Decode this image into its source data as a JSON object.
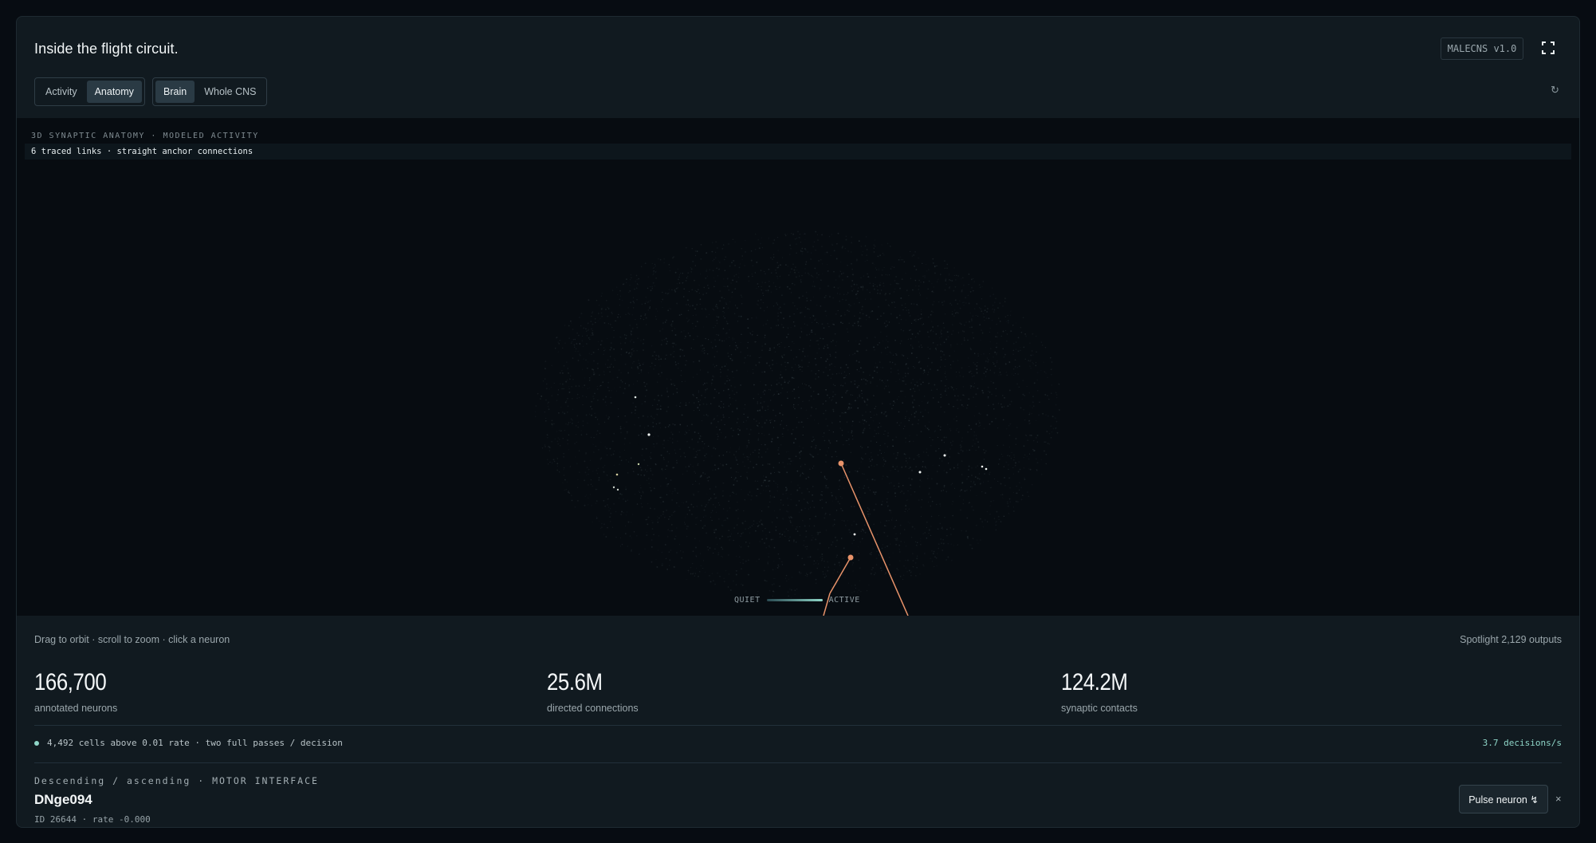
{
  "header": {
    "title": "Inside the flight circuit.",
    "version": "MALECNS v1.0",
    "refresh_glyph": "↻"
  },
  "view_toggle": {
    "options": [
      "Activity",
      "Anatomy"
    ],
    "selected": "Anatomy"
  },
  "scope_toggle": {
    "options": [
      "Brain",
      "Whole CNS"
    ],
    "selected": "Brain"
  },
  "viz": {
    "label": "3D SYNAPTIC ANATOMY · MODELED ACTIVITY",
    "status": "6 traced links · straight anchor connections",
    "legend_low": "QUIET",
    "legend_high": "ACTIVE",
    "accent_color": "#e8936a",
    "active_color": "#8fd6c8"
  },
  "hint": "Drag to orbit · scroll to zoom · click a neuron",
  "spotlight": "Spotlight 2,129 outputs",
  "stats": [
    {
      "value": "166,700",
      "label": "annotated neurons"
    },
    {
      "value": "25.6M",
      "label": "directed connections"
    },
    {
      "value": "124.2M",
      "label": "synaptic contacts"
    }
  ],
  "activity_summary": "4,492 cells above 0.01 rate · two full passes / decision",
  "decision_rate": "3.7 decisions/s",
  "selected_neuron": {
    "category": "Descending / ascending · MOTOR INTERFACE",
    "name": "DNge094",
    "meta": "ID 26644 · rate -0.000"
  },
  "pulse_button": "Pulse neuron ↯",
  "close_glyph": "×"
}
